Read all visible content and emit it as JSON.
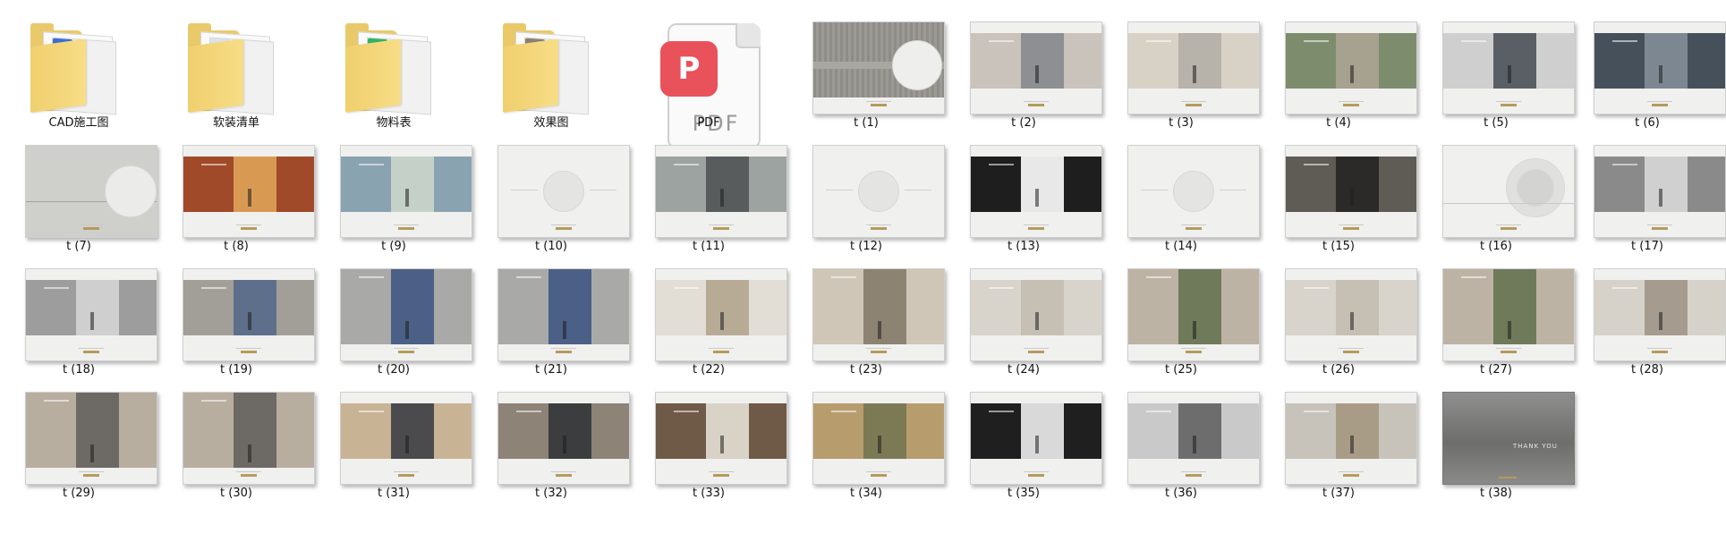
{
  "explorer": {
    "items": [
      {
        "label": "CAD施工图",
        "kind": "folder",
        "accent": "#3b6fd6"
      },
      {
        "label": "软装清单",
        "kind": "folder",
        "accent": "#d9e3ec"
      },
      {
        "label": "物料表",
        "kind": "folder",
        "accent": "#2db564"
      },
      {
        "label": "效果图",
        "kind": "folder",
        "accent": "#8a7f72"
      },
      {
        "label": "PDF",
        "kind": "pdf",
        "badge_icon": "pdf-app-icon",
        "badge_text": "P",
        "doc_text": "PDF"
      },
      {
        "label": "t (1)",
        "kind": "slide",
        "style": "stone-circle"
      },
      {
        "label": "t (2)",
        "kind": "slide",
        "style": "map-photo"
      },
      {
        "label": "t (3)",
        "kind": "slide",
        "style": "site-plan"
      },
      {
        "label": "t (4)",
        "kind": "slide",
        "style": "aerial-map"
      },
      {
        "label": "t (5)",
        "kind": "slide",
        "style": "gallery-3"
      },
      {
        "label": "t (6)",
        "kind": "slide",
        "style": "gallery-dark"
      },
      {
        "label": "t (7)",
        "kind": "slide",
        "style": "title-circle"
      },
      {
        "label": "t (8)",
        "kind": "slide",
        "style": "photo-strip-warm"
      },
      {
        "label": "t (9)",
        "kind": "slide",
        "style": "photo-strip-cool"
      },
      {
        "label": "t (10)",
        "kind": "slide",
        "style": "section-circle"
      },
      {
        "label": "t (11)",
        "kind": "slide",
        "style": "photo-row"
      },
      {
        "label": "t (12)",
        "kind": "slide",
        "style": "section-circle"
      },
      {
        "label": "t (13)",
        "kind": "slide",
        "style": "bw-row"
      },
      {
        "label": "t (14)",
        "kind": "slide",
        "style": "section-circle"
      },
      {
        "label": "t (15)",
        "kind": "slide",
        "style": "gallery-lights"
      },
      {
        "label": "t (16)",
        "kind": "slide",
        "style": "ripple"
      },
      {
        "label": "t (17)",
        "kind": "slide",
        "style": "plan-table"
      },
      {
        "label": "t (18)",
        "kind": "slide",
        "style": "floor-plan"
      },
      {
        "label": "t (19)",
        "kind": "slide",
        "style": "render-collage"
      },
      {
        "label": "t (20)",
        "kind": "slide",
        "style": "facade"
      },
      {
        "label": "t (21)",
        "kind": "slide",
        "style": "facade"
      },
      {
        "label": "t (22)",
        "kind": "slide",
        "style": "corridor"
      },
      {
        "label": "t (23)",
        "kind": "slide",
        "style": "corridor-tall"
      },
      {
        "label": "t (24)",
        "kind": "slide",
        "style": "model-room"
      },
      {
        "label": "t (25)",
        "kind": "slide",
        "style": "model-room-full"
      },
      {
        "label": "t (26)",
        "kind": "slide",
        "style": "model-room"
      },
      {
        "label": "t (27)",
        "kind": "slide",
        "style": "model-room-full"
      },
      {
        "label": "t (28)",
        "kind": "slide",
        "style": "lounge"
      },
      {
        "label": "t (29)",
        "kind": "slide",
        "style": "lounge-full"
      },
      {
        "label": "t (30)",
        "kind": "slide",
        "style": "lounge-full"
      },
      {
        "label": "t (31)",
        "kind": "slide",
        "style": "furniture"
      },
      {
        "label": "t (32)",
        "kind": "slide",
        "style": "interior-pair"
      },
      {
        "label": "t (33)",
        "kind": "slide",
        "style": "dining"
      },
      {
        "label": "t (34)",
        "kind": "slide",
        "style": "interior-pair-warm"
      },
      {
        "label": "t (35)",
        "kind": "slide",
        "style": "washroom"
      },
      {
        "label": "t (36)",
        "kind": "slide",
        "style": "materials"
      },
      {
        "label": "t (37)",
        "kind": "slide",
        "style": "material-swatch"
      },
      {
        "label": "t (38)",
        "kind": "slide",
        "style": "thank-you",
        "caption": "THANK YOU"
      }
    ]
  }
}
